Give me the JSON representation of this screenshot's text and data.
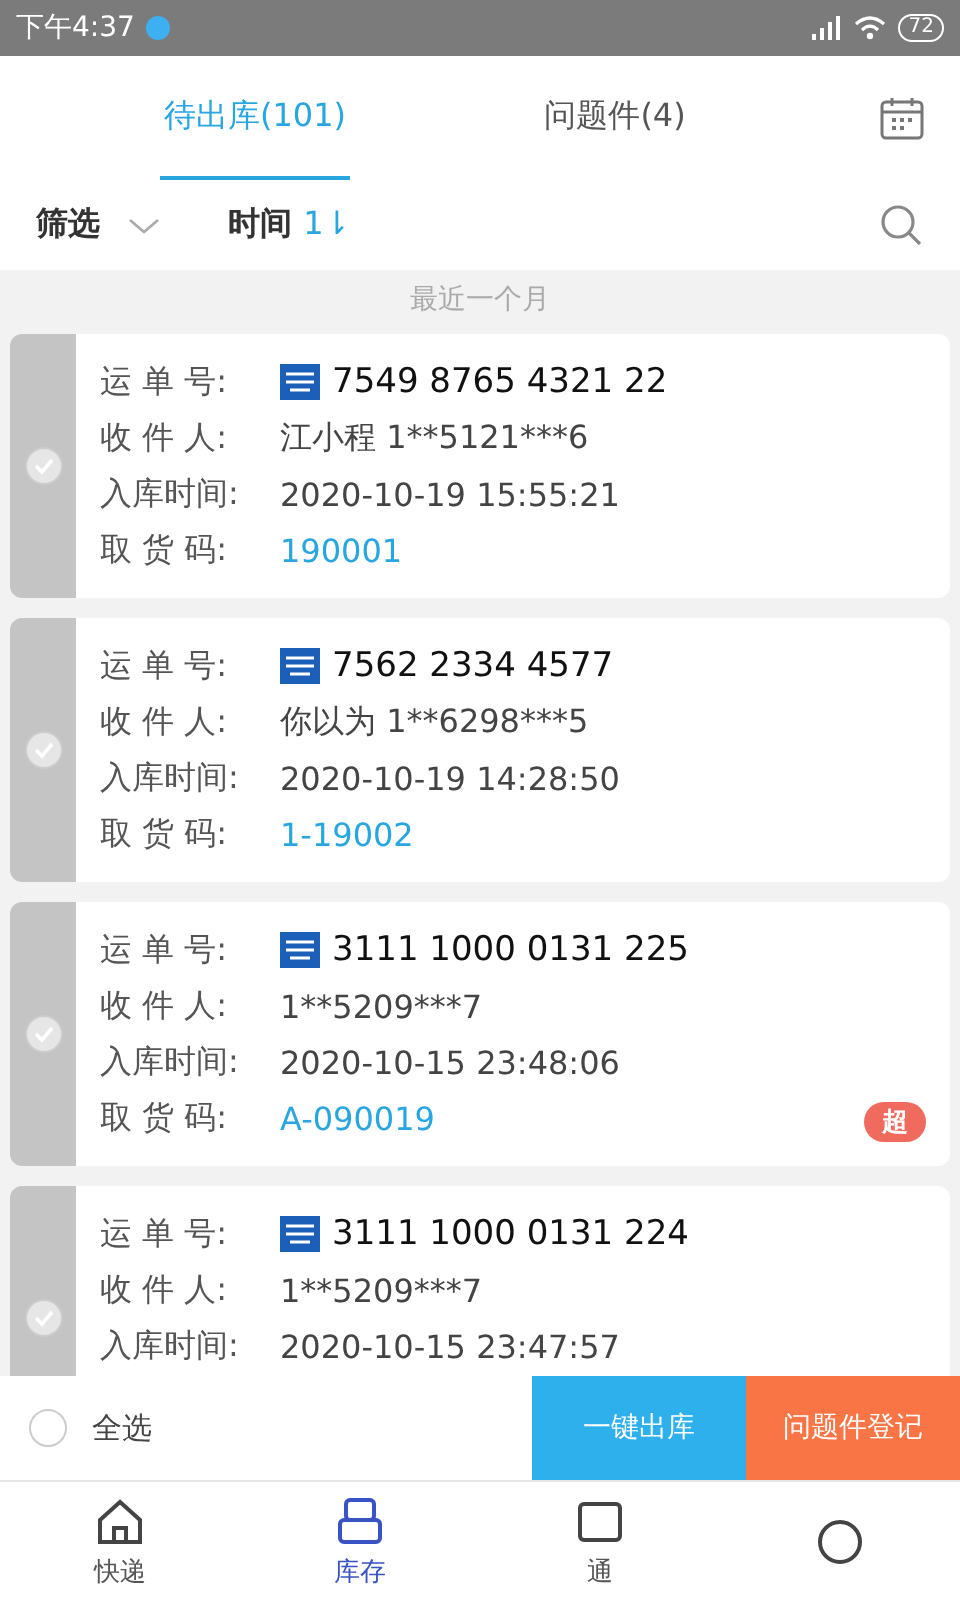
{
  "status_bar": {
    "time": "下午4:37",
    "battery": "72"
  },
  "tabs": [
    {
      "label": "待出库(101)",
      "selected": true
    },
    {
      "label": "问题件(4)",
      "selected": false
    }
  ],
  "filter_bar": {
    "filter": "筛选",
    "sort": "时间",
    "sort_icon": "1⇂"
  },
  "section_header": "最近一个月",
  "parcels": [
    {
      "checked": false,
      "rows": [
        {
          "label": "运 单 号:",
          "value": "7549 8765 4321 22",
          "kind": "tracking"
        },
        {
          "label": "收 件 人:",
          "value": "江小程 1**5121***6",
          "kind": "plain"
        },
        {
          "label": "入库时间:",
          "value": "2020-10-19 15:55:21",
          "kind": "plain"
        },
        {
          "label": "取 货 码:",
          "value": "190001",
          "kind": "code"
        }
      ]
    },
    {
      "checked": false,
      "rows": [
        {
          "label": "运 单 号:",
          "value": "7562 2334 4577",
          "kind": "tracking"
        },
        {
          "label": "收 件 人:",
          "value": "你以为 1**6298***5",
          "kind": "plain"
        },
        {
          "label": "入库时间:",
          "value": "2020-10-19 14:28:50",
          "kind": "plain"
        },
        {
          "label": "取 货 码:",
          "value": "1-19002",
          "kind": "code"
        }
      ]
    },
    {
      "checked": false,
      "badge": "超",
      "rows": [
        {
          "label": "运 单 号:",
          "value": "3111 1000 0131 225",
          "kind": "tracking"
        },
        {
          "label": "收 件 人:",
          "value": "1**5209***7",
          "kind": "plain"
        },
        {
          "label": "入库时间:",
          "value": "2020-10-15 23:48:06",
          "kind": "plain"
        },
        {
          "label": "取 货 码:",
          "value": "A-090019",
          "kind": "code"
        }
      ]
    },
    {
      "checked": false,
      "rows": [
        {
          "label": "运 单 号:",
          "value": "3111 1000 0131 224",
          "kind": "tracking"
        },
        {
          "label": "收 件 人:",
          "value": "1**5209***7",
          "kind": "plain"
        },
        {
          "label": "入库时间:",
          "value": "2020-10-15 23:47:57",
          "kind": "plain"
        }
      ]
    }
  ],
  "action_bar": {
    "select_all": {
      "label": "全选",
      "checked": false
    },
    "buttons": [
      {
        "label": "一键出库",
        "kind": "primary"
      },
      {
        "label": "问题件登记",
        "kind": "warning"
      }
    ]
  },
  "bottom_nav": [
    {
      "label": "快递",
      "kind": "home",
      "selected": false
    },
    {
      "label": "库存",
      "kind": "box",
      "selected": true
    },
    {
      "label": "通",
      "kind": "tray",
      "selected": false
    },
    {
      "kind": "circle",
      "selected": false
    }
  ]
}
